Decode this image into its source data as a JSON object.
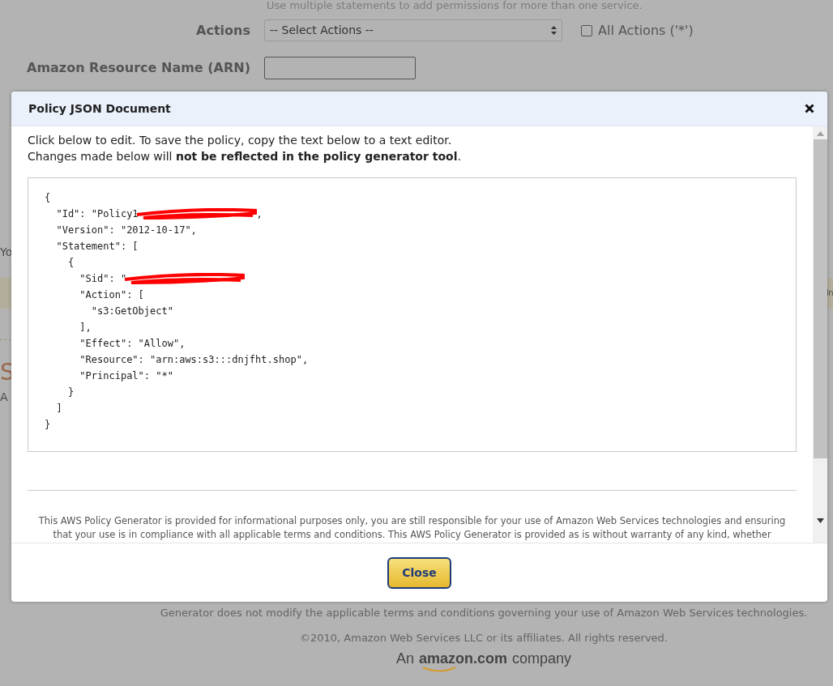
{
  "page": {
    "hint": "Use multiple statements to add permissions for more than one service.",
    "actions_label": "Actions",
    "actions_select": "-- Select Actions --",
    "all_actions": {
      "label": "All Actions ('*')",
      "checked": false
    },
    "arn_label": "Amazon Resource Name (ARN)",
    "left_fragments": [
      "Yo",
      "S",
      "A"
    ],
    "band_fragment": "In",
    "footer_lines": [
      "Generator does not modify the applicable terms and conditions governing your use of Amazon Web Services technologies.",
      "©2010, Amazon Web Services LLC or its affiliates. All rights reserved."
    ],
    "logo": {
      "prefix": "An",
      "brand": "amazon.com",
      "suffix": "company"
    }
  },
  "modal": {
    "title": "Policy JSON Document",
    "intro": "Click below to edit. To save the policy, copy the text below to a text editor.",
    "intro_2": "Changes made below will **not be reflected in the policy generator tool**.",
    "code_lines": [
      {
        "kind": "plain",
        "text": "{"
      },
      {
        "kind": "redacted",
        "before": "  \"Id\": \"Policy1",
        "after": ","
      },
      {
        "kind": "plain",
        "text": "  \"Version\": \"2012-10-17\","
      },
      {
        "kind": "plain",
        "text": "  \"Statement\": ["
      },
      {
        "kind": "plain",
        "text": "    {"
      },
      {
        "kind": "redacted",
        "before": "      \"Sid\": \""
      },
      {
        "kind": "plain",
        "text": "      \"Action\": ["
      },
      {
        "kind": "plain",
        "text": "        \"s3:GetObject\""
      },
      {
        "kind": "plain",
        "text": "      ],"
      },
      {
        "kind": "plain",
        "text": "      \"Effect\": \"Allow\","
      },
      {
        "kind": "plain",
        "text": "      \"Resource\": \"arn:aws:s3:::dnjfht.shop\","
      },
      {
        "kind": "plain",
        "text": "      \"Principal\": \"*\""
      },
      {
        "kind": "plain",
        "text": "    }"
      },
      {
        "kind": "plain",
        "text": "  ]"
      },
      {
        "kind": "plain",
        "text": "}"
      }
    ],
    "disclaimer": "This AWS Policy Generator is provided for informational purposes only, you are still responsible for your use of Amazon Web Services technologies and ensuring that your use is in compliance with all applicable terms and conditions. This AWS Policy Generator is provided as is without warranty of any kind, whether",
    "button": "Close"
  }
}
